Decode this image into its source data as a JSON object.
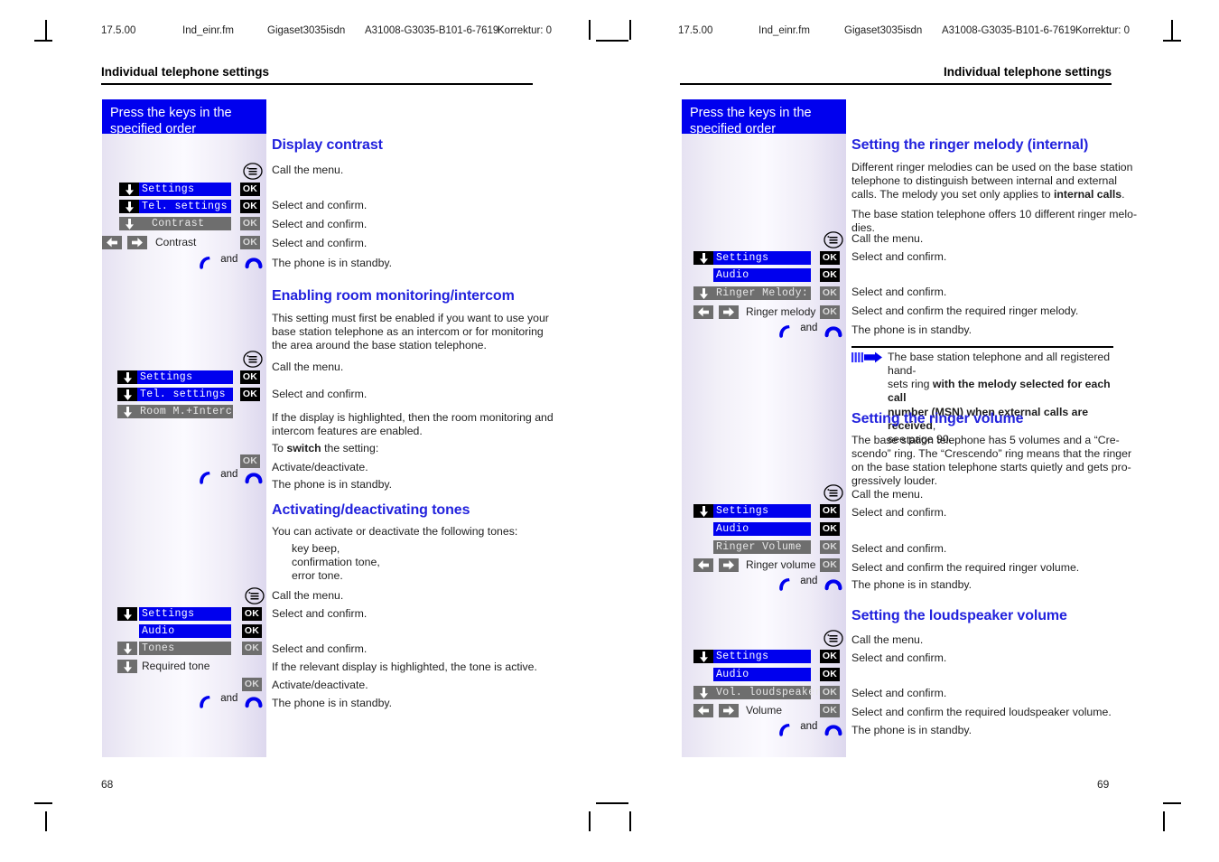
{
  "print_header": {
    "date": "17.5.00",
    "file": "Ind_einr.fm",
    "product": "Gigaset3035isdn",
    "docnum": "A31008-G3035-B101-6-7619",
    "correction": "Korrektur: 0"
  },
  "running_head": "Individual telephone settings",
  "keys_caption": "Press the keys in the\nspecified order",
  "keys_caption_line1": "Press the keys in the",
  "keys_caption_line2": "specified order",
  "labels": {
    "ok": "OK",
    "and": "and",
    "settings": "Settings",
    "tel_settings": "Tel. settings",
    "contrast_lcd": "Contrast",
    "contrast_plain": "Contrast",
    "room_interc": "Room M.+Interc.",
    "audio": "Audio",
    "tones": "Tones",
    "required_tone": "Required tone",
    "ringer_melody_lcd": "Ringer Melody:",
    "ringer_melody_plain": "Ringer melody",
    "ringer_volume_lcd": "Ringer Volume",
    "ringer_volume_plain": "Ringer volume",
    "vol_loudspeaker_lcd": "Vol. loudspeaker",
    "volume_plain": "Volume"
  },
  "left_page": {
    "folio": "68",
    "sections": [
      {
        "title": "Display contrast",
        "lines": [
          "Call the menu.",
          "Select and confirm.",
          "Select and confirm.",
          "Select and confirm.",
          "The phone is in standby."
        ]
      },
      {
        "title": "Enabling room monitoring/intercom",
        "intro": "This setting must first be enabled if you want to use your base station telephone as an intercom or for monitoring the area around the base station telephone.",
        "intro_lines": [
          "This setting must first be enabled if you want to use your",
          "base station telephone as an intercom or for monitoring",
          "the area around the base station telephone."
        ],
        "lines": [
          "Call the menu.",
          "Select and confirm.",
          "If the display is highlighted, then the room monitoring and",
          "intercom features are enabled.",
          "Activate/deactivate.",
          "The phone is in standby."
        ],
        "switch_prefix": "To ",
        "switch_bold": "switch",
        "switch_suffix": " the setting:"
      },
      {
        "title": "Activating/deactivating tones",
        "intro": "You can activate or deactivate the following tones:",
        "bullets": [
          "key beep,",
          "confirmation tone,",
          "error tone."
        ],
        "lines": [
          "Call the menu.",
          "Select and confirm.",
          "Select and confirm.",
          "If the relevant display is highlighted, the tone is active.",
          "Activate/deactivate.",
          "The phone is in standby."
        ]
      }
    ]
  },
  "right_page": {
    "folio": "69",
    "sections": [
      {
        "title": "Setting the ringer melody (internal)",
        "p1_a": "Different ringer melodies can be used on the base station telephone to distinguish between internal and external calls. The melody you set only applies to ",
        "p1_bold": "internal calls",
        "p1_b": ".",
        "p1_lines": [
          "Different ringer melodies can be used on the base station",
          "telephone to distinguish between internal and external"
        ],
        "p1_last_a": "calls. The melody you set only applies to ",
        "p1_last_bold": "internal calls",
        "p1_last_b": ".",
        "p2_lines": [
          "The base station telephone offers 10 different ringer melo-",
          "dies."
        ],
        "lines": [
          "Call the menu.",
          "Select and confirm.",
          "Select and confirm.",
          "Select and confirm the required ringer melody.",
          "The phone is in standby."
        ],
        "note": {
          "l1_a": "The base station telephone and all registered hand-",
          "l2_a": "sets ring ",
          "l2_bold": "with the melody selected for each call",
          "l3_bold": "number (MSN) when external calls are received",
          "l3_b": ",",
          "l4": "see page 90."
        }
      },
      {
        "title": "Setting the ringer volume",
        "intro_lines": [
          "The base station telephone has 5 volumes and a “Cre-",
          "scendo” ring. The “Crescendo” ring means that the ringer",
          "on the base station telephone starts quietly and gets pro-",
          "gressively louder."
        ],
        "lines": [
          "Call the menu.",
          "Select and confirm.",
          "Select and confirm.",
          "Select and confirm the required ringer volume.",
          "The phone is in standby."
        ]
      },
      {
        "title": "Setting the loudspeaker volume",
        "lines": [
          "Call the menu.",
          "Select and confirm.",
          "Select and confirm.",
          "Select and confirm the required loudspeaker volume.",
          "The phone is in standby."
        ]
      }
    ]
  },
  "colors": {
    "accent_blue": "#0000ee",
    "heading_blue": "#2222dd",
    "lcd_grey": "#6e6e6e",
    "key_black": "#000000"
  }
}
